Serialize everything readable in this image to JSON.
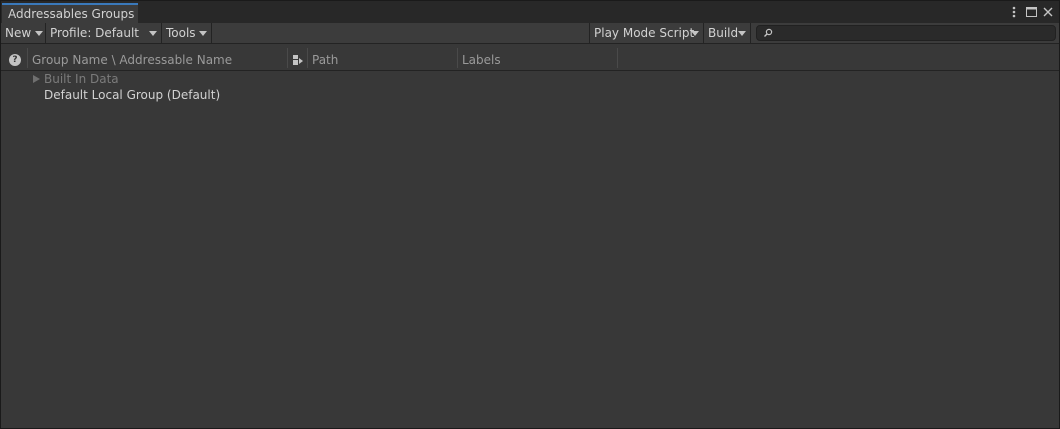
{
  "window": {
    "tab_title": "Addressables Groups",
    "menu_icon": "kebab-menu-icon",
    "maximize_icon": "maximize-icon",
    "close_icon": "close-icon"
  },
  "toolbar": {
    "new_label": "New",
    "profile_label": "Profile: Default",
    "tools_label": "Tools",
    "play_mode_label": "Play Mode Script",
    "build_label": "Build",
    "search": {
      "value": "",
      "placeholder": "",
      "icon": "search-icon"
    }
  },
  "columns": {
    "help_icon_glyph": "?",
    "group_name": "Group Name \\ Addressable Name",
    "path": "Path",
    "labels": "Labels"
  },
  "tree": {
    "rows": [
      {
        "label": "Built In Data",
        "expandable": true,
        "disabled": true
      },
      {
        "label": "Default Local Group (Default)",
        "expandable": false,
        "disabled": false
      }
    ]
  },
  "colors": {
    "window_bg": "#383838",
    "toolbar_bg": "#3c3c3c",
    "tab_accent": "#3a79bb",
    "text": "#d2d2d2",
    "muted_text": "#7b7b7b"
  }
}
